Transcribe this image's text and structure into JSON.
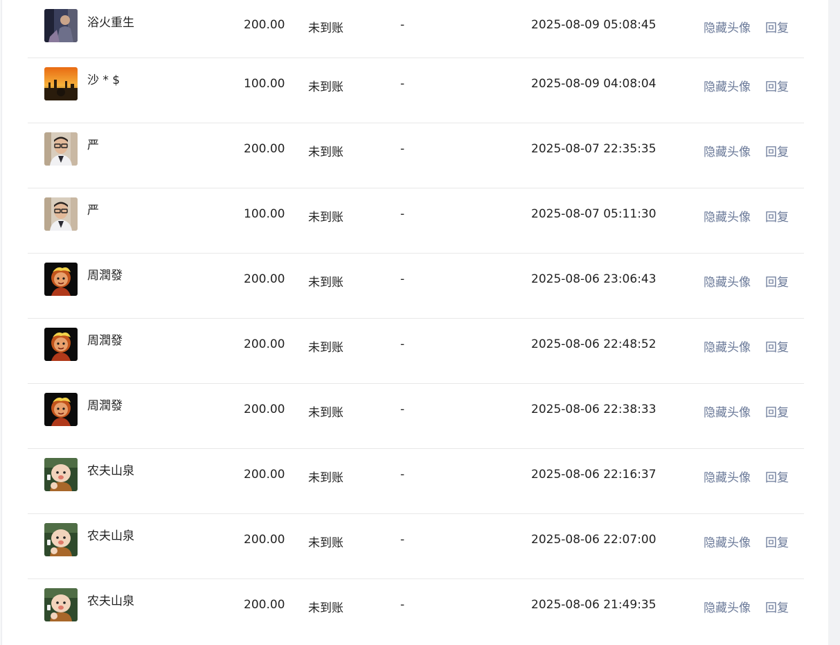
{
  "actions": {
    "hide_avatar": "隐藏头像",
    "reply": "回复"
  },
  "records": [
    {
      "name": "浴火重生",
      "amount": "200.00",
      "status": "未到账",
      "remark": "-",
      "time": "2025-08-09 05:08:45",
      "avatar": "avatar-user-purple-portrait"
    },
    {
      "name": "沙 * $",
      "amount": "100.00",
      "status": "未到账",
      "remark": "-",
      "time": "2025-08-09 04:08:04",
      "avatar": "avatar-sunset-silhouette"
    },
    {
      "name": "严",
      "amount": "200.00",
      "status": "未到账",
      "remark": "-",
      "time": "2025-08-07 22:35:35",
      "avatar": "avatar-man-glasses"
    },
    {
      "name": "严",
      "amount": "100.00",
      "status": "未到账",
      "remark": "-",
      "time": "2025-08-07 05:11:30",
      "avatar": "avatar-man-glasses"
    },
    {
      "name": "周潤發",
      "amount": "200.00",
      "status": "未到账",
      "remark": "-",
      "time": "2025-08-06 23:06:43",
      "avatar": "avatar-fiery-portrait"
    },
    {
      "name": "周潤發",
      "amount": "200.00",
      "status": "未到账",
      "remark": "-",
      "time": "2025-08-06 22:48:52",
      "avatar": "avatar-fiery-portrait"
    },
    {
      "name": "周潤發",
      "amount": "200.00",
      "status": "未到账",
      "remark": "-",
      "time": "2025-08-06 22:38:33",
      "avatar": "avatar-fiery-portrait"
    },
    {
      "name": "农夫山泉",
      "amount": "200.00",
      "status": "未到账",
      "remark": "-",
      "time": "2025-08-06 22:16:37",
      "avatar": "avatar-cartoon-baby-monk"
    },
    {
      "name": "农夫山泉",
      "amount": "200.00",
      "status": "未到账",
      "remark": "-",
      "time": "2025-08-06 22:07:00",
      "avatar": "avatar-cartoon-baby-monk"
    },
    {
      "name": "农夫山泉",
      "amount": "200.00",
      "status": "未到账",
      "remark": "-",
      "time": "2025-08-06 21:49:35",
      "avatar": "avatar-cartoon-baby-monk"
    }
  ]
}
